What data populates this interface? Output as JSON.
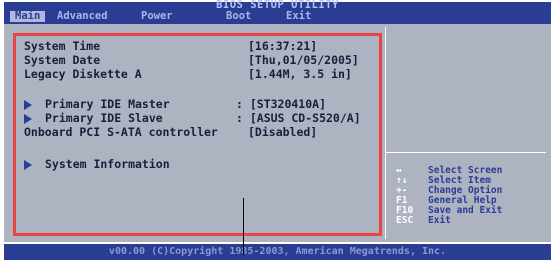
{
  "header": {
    "title": "BIOS SETUP UTILITY",
    "tabs": [
      "Main",
      "Advanced",
      "Power",
      "Boot",
      "Exit"
    ],
    "active_tab": "Main"
  },
  "main": {
    "system_time_label": "System Time",
    "system_time_value": "[16:37:21]",
    "system_date_label": "System Date",
    "system_date_value": "[Thu,01/05/2005]",
    "legacy_diskette_label": "Legacy Diskette A",
    "legacy_diskette_value": "[1.44M, 3.5 in]",
    "primary_master_label": "Primary IDE Master",
    "primary_master_value": ": [ST320410A]",
    "primary_slave_label": "Primary IDE Slave",
    "primary_slave_value": ": [ASUS CD-S520/A]",
    "pci_sata_label": "Onboard PCI S-ATA controller",
    "pci_sata_value": "[Disabled]",
    "system_info_label": "System Information"
  },
  "help": [
    {
      "key": "↔",
      "desc": "Select Screen"
    },
    {
      "key": "↑↓",
      "desc": "Select Item"
    },
    {
      "key": "+-",
      "desc": "Change Option"
    },
    {
      "key": "F1",
      "desc": "General Help"
    },
    {
      "key": "F10",
      "desc": "Save and Exit"
    },
    {
      "key": "ESC",
      "desc": "Exit"
    }
  ],
  "footer": {
    "text": "v00.00 (C)Copyright 1985-2003, American Megatrends, Inc."
  },
  "colors": {
    "title_bar": "#2a3d95",
    "panel": "#aeb3c2",
    "highlight_box": "#e64545",
    "help_desc": "#2a3d95"
  }
}
